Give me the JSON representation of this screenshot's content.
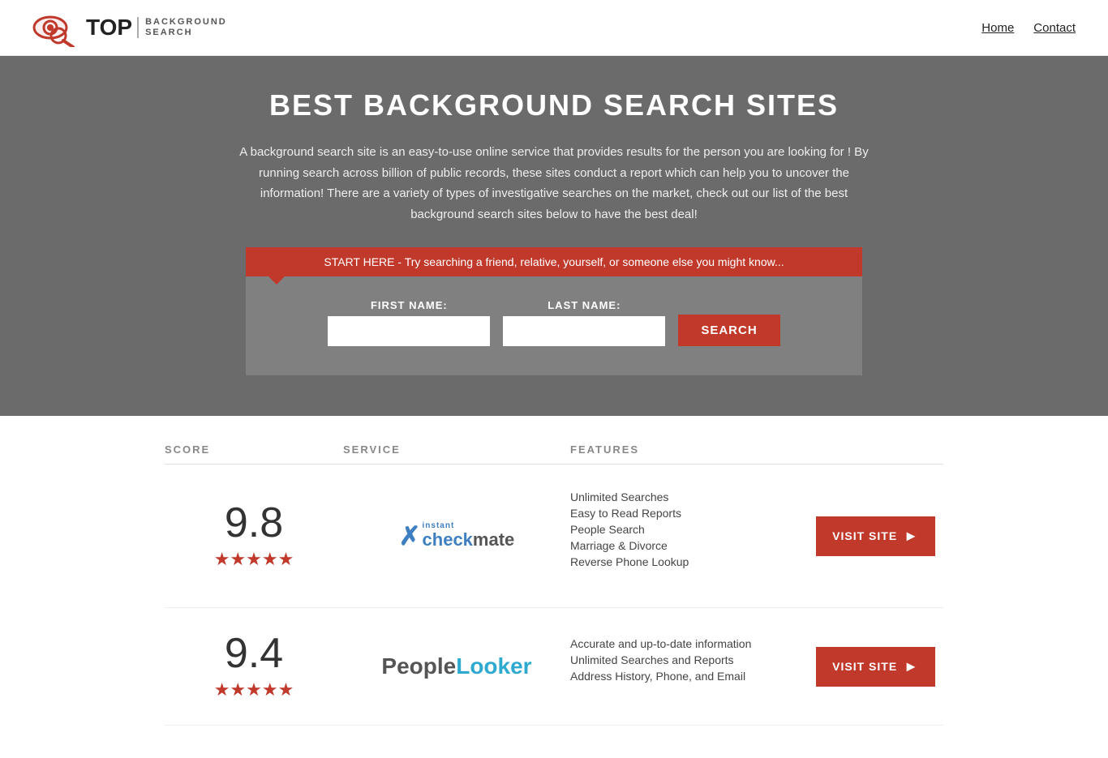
{
  "header": {
    "logo_top": "TOP",
    "logo_subtitle_line1": "BACKGROUND",
    "logo_subtitle_line2": "SEARCH",
    "nav": [
      {
        "label": "Home",
        "href": "#"
      },
      {
        "label": "Contact",
        "href": "#"
      }
    ]
  },
  "hero": {
    "title": "BEST BACKGROUND SEARCH SITES",
    "description": "A background search site is an easy-to-use online service that provides results  for the person you are looking for ! By  running  search across billion of public records, these sites conduct  a report which can help you to uncover the information! There are a variety of types of investigative searches on the market, check out our  list of the best background search sites below to have the best deal!",
    "search_banner": "START HERE - Try searching a friend, relative, yourself, or someone else you might know..."
  },
  "search_form": {
    "first_name_label": "FIRST NAME:",
    "last_name_label": "LAST NAME:",
    "button_label": "SEARCH"
  },
  "table": {
    "headers": {
      "score": "SCORE",
      "service": "SERVICE",
      "features": "FEATURES"
    },
    "rows": [
      {
        "score": "9.8",
        "stars": 5,
        "service_name": "Instant Checkmate",
        "service_logo_type": "checkmate",
        "features": [
          "Unlimited Searches",
          "Easy to Read Reports",
          "People Search",
          "Marriage & Divorce",
          "Reverse Phone Lookup"
        ],
        "visit_label": "VISIT SITE"
      },
      {
        "score": "9.4",
        "stars": 5,
        "service_name": "PeopleLooker",
        "service_logo_type": "peoplelooker",
        "features": [
          "Accurate and up-to-date information",
          "Unlimited Searches and Reports",
          "Address History, Phone, and Email"
        ],
        "visit_label": "VISIT SITE"
      }
    ]
  }
}
